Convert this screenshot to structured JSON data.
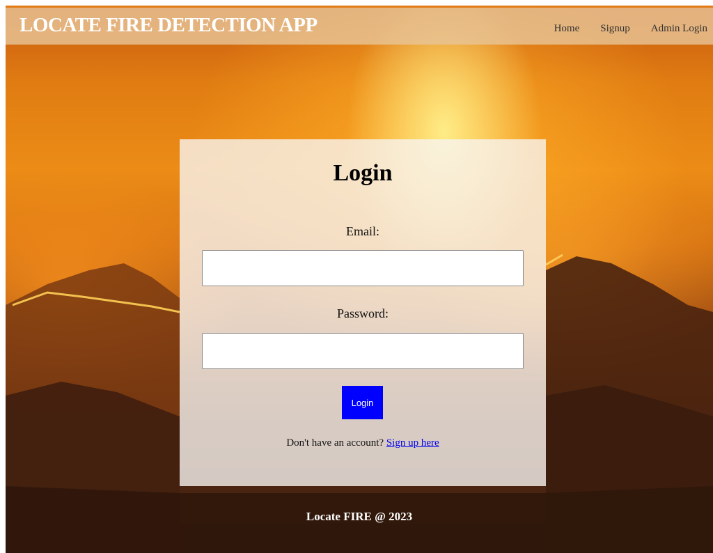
{
  "navbar": {
    "brand": "LOCATE FIRE DETECTION APP",
    "links": [
      {
        "label": "Home"
      },
      {
        "label": "Signup"
      },
      {
        "label": "Admin Login"
      }
    ]
  },
  "login": {
    "title": "Login",
    "email_label": "Email:",
    "email_value": "",
    "password_label": "Password:",
    "password_value": "",
    "button_label": "Login",
    "signup_prompt": "Don't have an account? ",
    "signup_link": "Sign up here"
  },
  "footer": {
    "text": "Locate FIRE @ 2023"
  },
  "colors": {
    "navbar_bg": "#e8c496",
    "accent_strip": "#e27a16",
    "button_bg": "#0000ff",
    "link": "#0000ee",
    "card_bg": "#f7f4f0"
  }
}
